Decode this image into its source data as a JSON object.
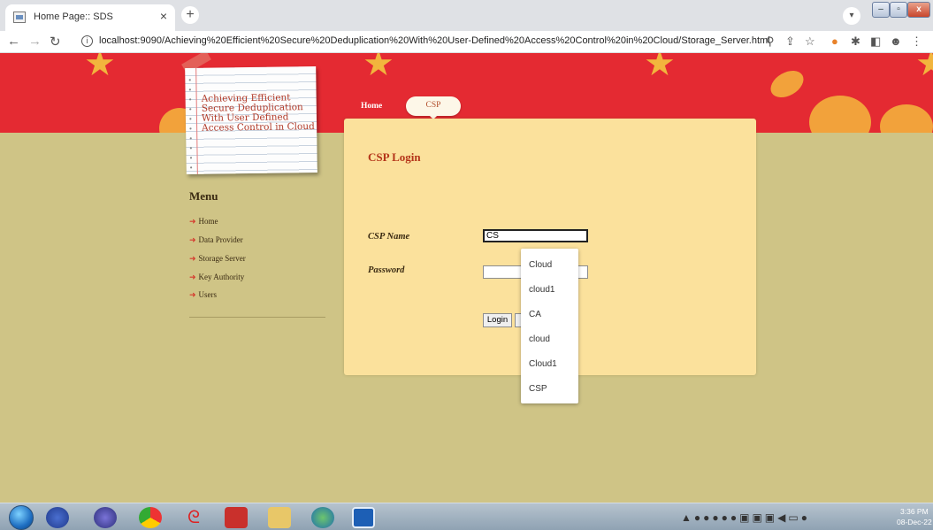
{
  "browser": {
    "tab_title": "Home Page:: SDS",
    "tab_close": "×",
    "new_tab": "+",
    "url": "localhost:9090/Achieving%20Efficient%20Secure%20Deduplication%20With%20User-Defined%20Access%20Control%20in%20Cloud/Storage_Server.html"
  },
  "site": {
    "notepaper_lines": [
      "Achieving Efficient",
      "Secure Deduplication",
      "With User Defined",
      "Access Control in Cloud"
    ],
    "nav": {
      "home": "Home",
      "csp": "CSP"
    },
    "menu": {
      "title": "Menu",
      "items": [
        {
          "label": "Home"
        },
        {
          "label": "Data Provider"
        },
        {
          "label": "Storage Server"
        },
        {
          "label": "Key Authority"
        },
        {
          "label": "Users"
        }
      ]
    },
    "login": {
      "title": "CSP Login",
      "name_label": "CSP Name",
      "name_value": "CS",
      "password_label": "Password",
      "password_value": "",
      "login_button": "Login"
    },
    "autocomplete": [
      "Cloud",
      "cloud1",
      "CA",
      "cloud",
      "Cloud1",
      "CSP"
    ]
  },
  "taskbar": {
    "time": "3:36 PM",
    "date": "08-Dec-22"
  }
}
